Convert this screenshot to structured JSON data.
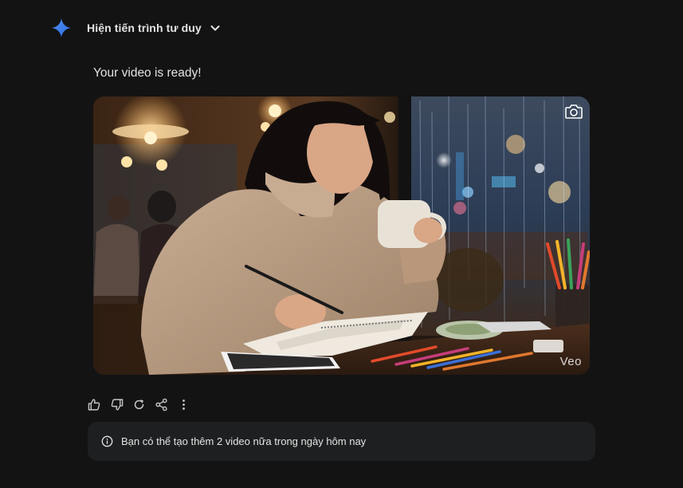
{
  "thinking": {
    "label": "Hiện tiến trình tư duy",
    "spark_icon": "gemini-spark-icon",
    "chevron_icon": "chevron-down-icon"
  },
  "message": {
    "ready_text": "Your video is ready!"
  },
  "video": {
    "watermark": "Veo",
    "camera_icon": "camera-icon",
    "scene": "woman in beige turtleneck sketching in notebook and holding a mug at a cafe window with rain"
  },
  "actions": [
    {
      "name": "thumbs-up-icon"
    },
    {
      "name": "thumbs-down-icon"
    },
    {
      "name": "regenerate-icon"
    },
    {
      "name": "share-icon"
    },
    {
      "name": "more-vert-icon"
    }
  ],
  "notice": {
    "icon": "info-icon",
    "text": "Bạn có thể tạo thêm 2 video nữa trong ngày hôm nay"
  },
  "colors": {
    "background": "#131314",
    "banner": "#1e1f20",
    "text": "#e3e3e3",
    "accent": "#4285f4"
  }
}
